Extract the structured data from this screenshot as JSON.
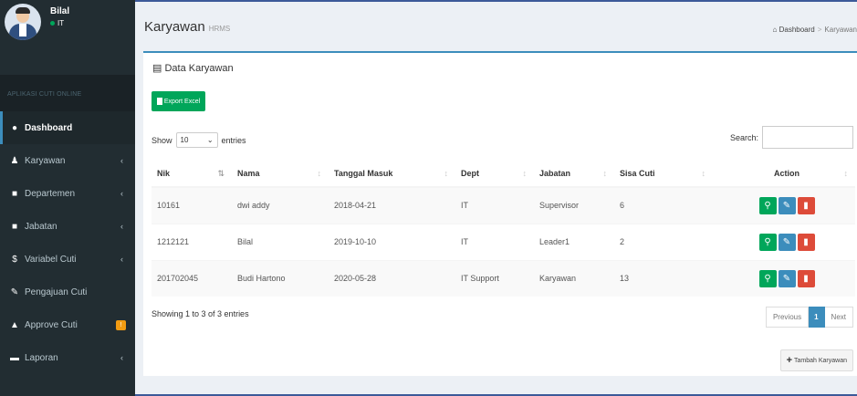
{
  "user": {
    "name": "Bilal",
    "status": "IT"
  },
  "sidebar": {
    "header": "APLIKASI CUTI ONLINE",
    "items": [
      {
        "label": "Dashboard",
        "icon": "dashboard-icon",
        "glyph": "●",
        "active": true
      },
      {
        "label": "Karyawan",
        "icon": "user-icon",
        "glyph": "♟",
        "chev": "‹"
      },
      {
        "label": "Departemen",
        "icon": "book-icon",
        "glyph": "■",
        "chev": "‹"
      },
      {
        "label": "Jabatan",
        "icon": "book-icon",
        "glyph": "■",
        "chev": "‹"
      },
      {
        "label": "Variabel Cuti",
        "icon": "dollar-icon",
        "glyph": "$",
        "chev": "‹"
      },
      {
        "label": "Pengajuan Cuti",
        "icon": "edit-icon",
        "glyph": "✎"
      },
      {
        "label": "Approve Cuti",
        "icon": "lock-icon",
        "glyph": "▲",
        "badge": "!"
      },
      {
        "label": "Laporan",
        "icon": "file-icon",
        "glyph": "▬",
        "chev": "‹"
      }
    ]
  },
  "header": {
    "title": "Karyawan",
    "subtitle": "HRMS"
  },
  "breadcrumb": {
    "home_icon": "⌂",
    "home": "Dashboard",
    "separator": ">",
    "current": "Karyawan"
  },
  "box": {
    "title": "Data Karyawan",
    "export_label": "Export Excel",
    "show_label": "Show",
    "entries_value": "10",
    "entries_label": "entries",
    "search_label": "Search:",
    "search_placeholder": ""
  },
  "table": {
    "columns": [
      "Nik",
      "Nama",
      "Tanggal Masuk",
      "Dept",
      "Jabatan",
      "Sisa Cuti",
      "Action"
    ],
    "rows": [
      [
        "10161",
        "dwi addy",
        "2018-04-21",
        "IT",
        "Supervisor",
        "6"
      ],
      [
        "1212121",
        "Bilal",
        "2019-10-10",
        "IT",
        "Leader1",
        "2"
      ],
      [
        "201702045",
        "Budi Hartono",
        "2020-05-28",
        "IT Support",
        "Karyawan",
        "13"
      ]
    ]
  },
  "footer": {
    "info": "Showing 1 to 3 of 3 entries",
    "previous": "Previous",
    "page": "1",
    "next": "Next",
    "add_label": "Tambah Karyawan"
  },
  "colors": {
    "sidebar": "#222d32",
    "accent": "#3c8dbc",
    "success": "#00a65a",
    "danger": "#dd4b39",
    "warning": "#f39c12"
  }
}
